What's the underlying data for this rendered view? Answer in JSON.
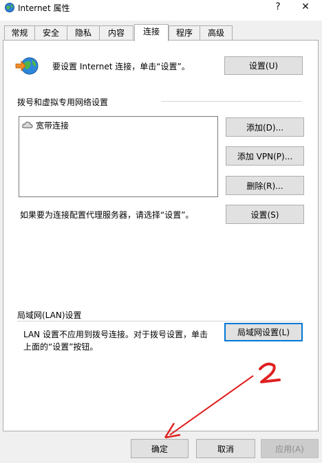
{
  "window": {
    "title": "Internet 属性",
    "help_glyph": "?",
    "close_glyph": "✕"
  },
  "tabs": [
    {
      "label": "常规",
      "active": false
    },
    {
      "label": "安全",
      "active": false
    },
    {
      "label": "隐私",
      "active": false
    },
    {
      "label": "内容",
      "active": false
    },
    {
      "label": "连接",
      "active": true
    },
    {
      "label": "程序",
      "active": false
    },
    {
      "label": "高级",
      "active": false
    }
  ],
  "setup": {
    "text": "要设置 Internet 连接，单击“设置”。",
    "button": "设置(U)"
  },
  "dialup": {
    "section_title": "拨号和虚拟专用网络设置",
    "connections": [
      "宽带连接"
    ],
    "add_button": "添加(D)...",
    "add_vpn_button": "添加 VPN(P)...",
    "remove_button": "删除(R)...",
    "proxy_text": "如果要为连接配置代理服务器，请选择“设置”。",
    "settings_button": "设置(S)"
  },
  "lan": {
    "section_title": "局域网(LAN)设置",
    "text_line1": "LAN 设置不应用到拨号连接。对于拨号设置，单击",
    "text_line2": "上面的“设置”按钮。",
    "button": "局域网设置(L)"
  },
  "footer": {
    "ok": "确定",
    "cancel": "取消",
    "apply": "应用(A)"
  },
  "annotation": {
    "number": "2",
    "color": "#e02020"
  }
}
